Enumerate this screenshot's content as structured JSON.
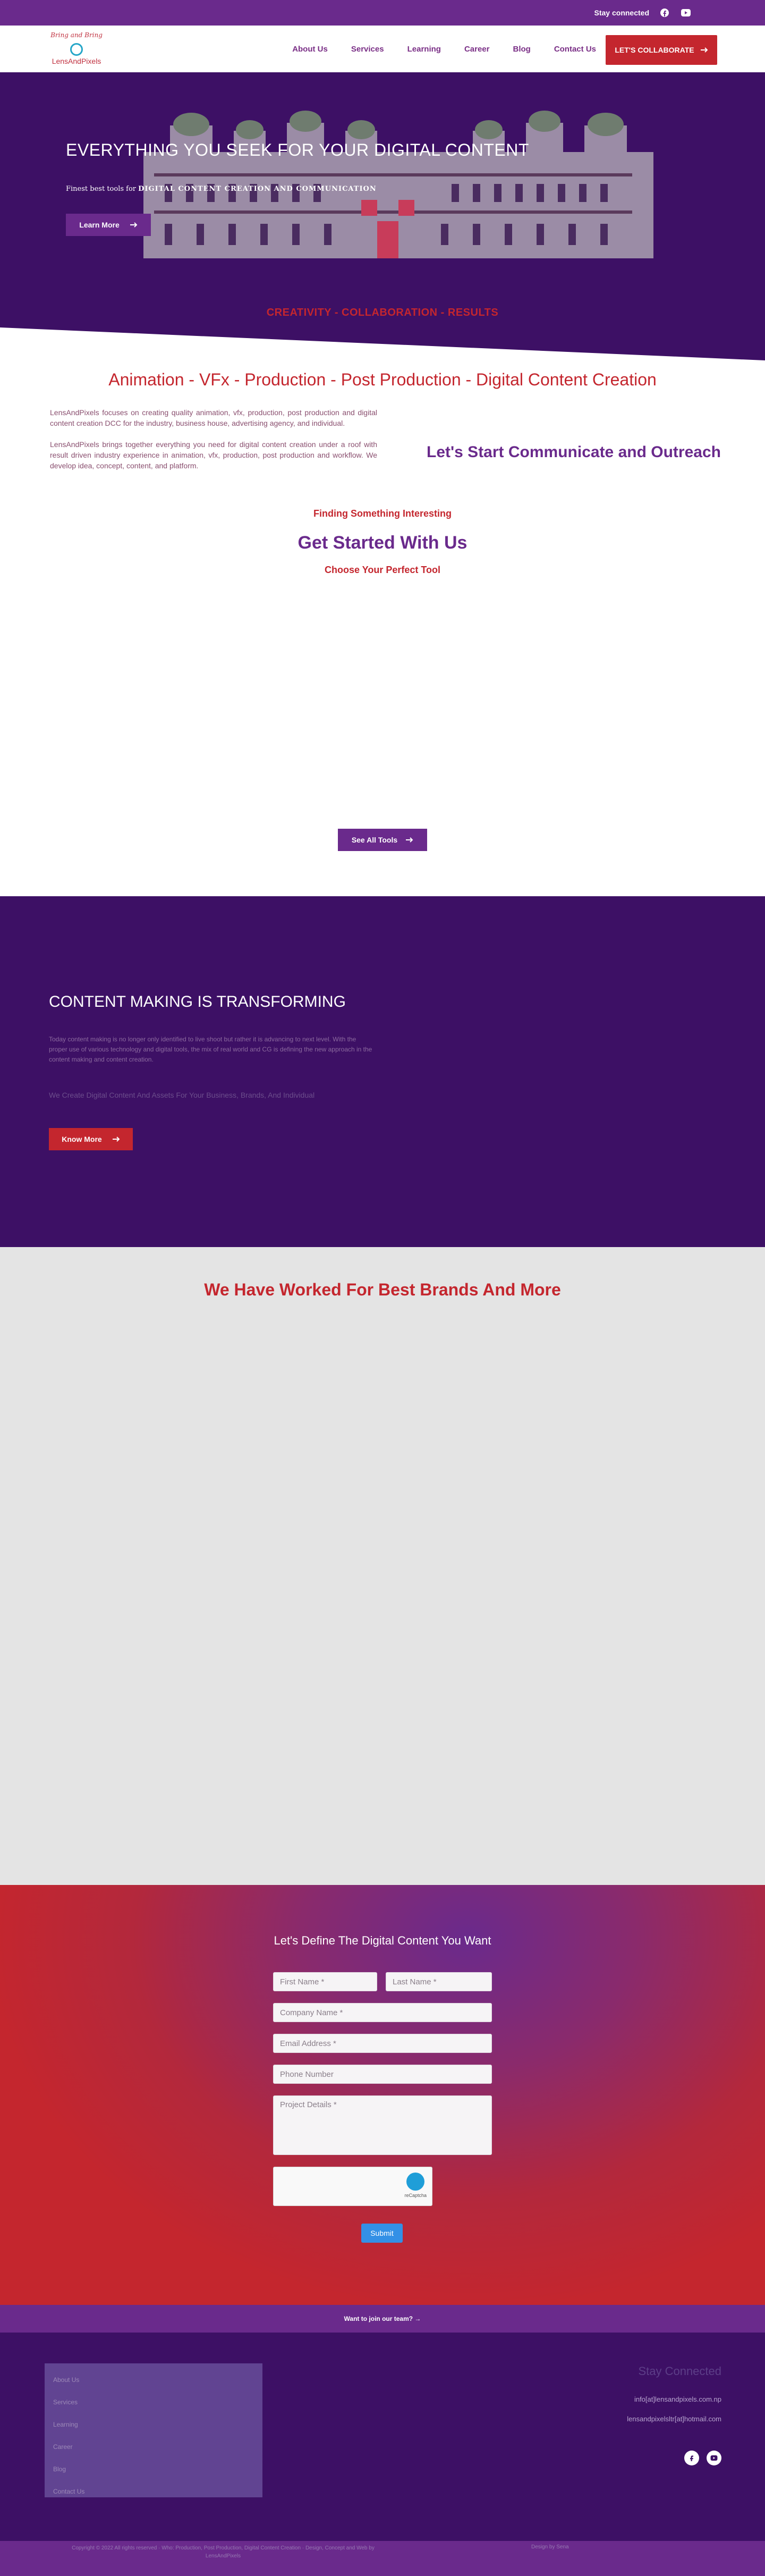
{
  "topbar": {
    "stay_label": "Stay connected",
    "link_text": "",
    "icons": [
      "facebook-icon",
      "youtube-icon"
    ]
  },
  "header": {
    "logo_tag": "Bring and Bring",
    "logo_name": "LensAndPixels",
    "nav": [
      "About Us",
      "Services",
      "Learning",
      "Career",
      "Blog",
      "Contact Us"
    ],
    "cta": "LET'S COLLABORATE"
  },
  "hero": {
    "title": "EVERYTHING YOU SEEK FOR YOUR DIGITAL CONTENT",
    "subtitle_prefix": "Finest best tools for",
    "subtitle_emph": "DIGITAL CONTENT CREATION AND COMMUNICATION",
    "button": "Learn More",
    "tagline": "CREATIVITY - COLLABORATION - RESULTS"
  },
  "intro": {
    "title": "Animation - VFx - Production - Post Production - Digital Content Creation",
    "p1": "LensAndPixels focuses on creating quality animation, vfx, production, post production and digital content creation DCC for the industry, business house, advertising agency, and individual.",
    "p2": "LensAndPixels brings together everything you need for digital content creation under a roof with result driven industry experience in animation, vfx, production, post production and workflow. We develop idea, concept, content, and platform.",
    "right": "Let's Start Communicate and Outreach"
  },
  "tools": {
    "kicker": "Finding Something Interesting",
    "heading": "Get Started With Us",
    "sub": "Choose Your Perfect Tool",
    "button": "See All Tools"
  },
  "transform": {
    "title": "CONTENT MAKING IS TRANSFORMING",
    "text": "Today content making is no longer only identified to live shoot but rather it is advancing to next level. With the proper use of various technology and digital tools, the mix of real world and CG is defining the new approach in the content making and content creation.",
    "muted": "We Create Digital Content And Assets For Your Business, Brands, And Individual",
    "button": "Know More"
  },
  "brands": {
    "title": "We Have Worked For Best Brands And More"
  },
  "contact": {
    "title": "Let's Define The Digital Content You Want",
    "fields": {
      "first": "First Name *",
      "last": "Last Name *",
      "company": "Company Name *",
      "email": "Email Address *",
      "phone": "Phone Number",
      "details": "Project Details *"
    },
    "captcha_label": "reCaptcha",
    "submit": "Submit"
  },
  "join": {
    "text": "Want to join our team? →"
  },
  "footer": {
    "menu": [
      "About Us",
      "Services",
      "Learning",
      "Career",
      "Blog",
      "Contact Us"
    ],
    "heading": "Stay Connected",
    "email1": "info[at]lensandpixels.com.np",
    "email2": "lensandpixelsltr[at]hotmail.com",
    "copyright": "Copyright © 2022 All rights reserved · Who: Production, Post Production, Digital Content Creation · Design, Concept and Web by LensAndPixels",
    "credit": "Design by Sena"
  },
  "colors": {
    "brand_purple": "#6a2a8c",
    "dark_purple": "#3d1065",
    "brand_red": "#c4262e"
  }
}
